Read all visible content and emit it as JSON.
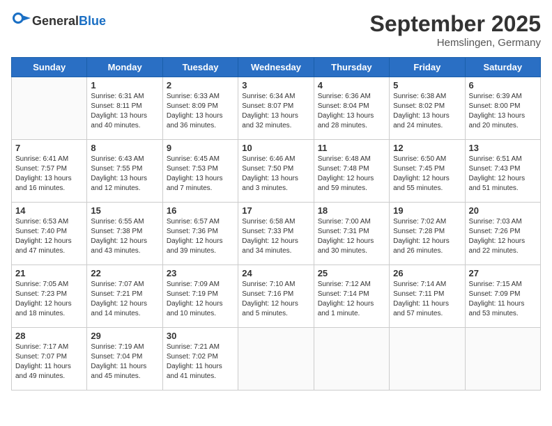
{
  "header": {
    "logo_general": "General",
    "logo_blue": "Blue",
    "month": "September 2025",
    "location": "Hemslingen, Germany"
  },
  "days_of_week": [
    "Sunday",
    "Monday",
    "Tuesday",
    "Wednesday",
    "Thursday",
    "Friday",
    "Saturday"
  ],
  "weeks": [
    [
      {
        "day": "",
        "details": []
      },
      {
        "day": "1",
        "details": [
          "Sunrise: 6:31 AM",
          "Sunset: 8:11 PM",
          "Daylight: 13 hours",
          "and 40 minutes."
        ]
      },
      {
        "day": "2",
        "details": [
          "Sunrise: 6:33 AM",
          "Sunset: 8:09 PM",
          "Daylight: 13 hours",
          "and 36 minutes."
        ]
      },
      {
        "day": "3",
        "details": [
          "Sunrise: 6:34 AM",
          "Sunset: 8:07 PM",
          "Daylight: 13 hours",
          "and 32 minutes."
        ]
      },
      {
        "day": "4",
        "details": [
          "Sunrise: 6:36 AM",
          "Sunset: 8:04 PM",
          "Daylight: 13 hours",
          "and 28 minutes."
        ]
      },
      {
        "day": "5",
        "details": [
          "Sunrise: 6:38 AM",
          "Sunset: 8:02 PM",
          "Daylight: 13 hours",
          "and 24 minutes."
        ]
      },
      {
        "day": "6",
        "details": [
          "Sunrise: 6:39 AM",
          "Sunset: 8:00 PM",
          "Daylight: 13 hours",
          "and 20 minutes."
        ]
      }
    ],
    [
      {
        "day": "7",
        "details": [
          "Sunrise: 6:41 AM",
          "Sunset: 7:57 PM",
          "Daylight: 13 hours",
          "and 16 minutes."
        ]
      },
      {
        "day": "8",
        "details": [
          "Sunrise: 6:43 AM",
          "Sunset: 7:55 PM",
          "Daylight: 13 hours",
          "and 12 minutes."
        ]
      },
      {
        "day": "9",
        "details": [
          "Sunrise: 6:45 AM",
          "Sunset: 7:53 PM",
          "Daylight: 13 hours",
          "and 7 minutes."
        ]
      },
      {
        "day": "10",
        "details": [
          "Sunrise: 6:46 AM",
          "Sunset: 7:50 PM",
          "Daylight: 13 hours",
          "and 3 minutes."
        ]
      },
      {
        "day": "11",
        "details": [
          "Sunrise: 6:48 AM",
          "Sunset: 7:48 PM",
          "Daylight: 12 hours",
          "and 59 minutes."
        ]
      },
      {
        "day": "12",
        "details": [
          "Sunrise: 6:50 AM",
          "Sunset: 7:45 PM",
          "Daylight: 12 hours",
          "and 55 minutes."
        ]
      },
      {
        "day": "13",
        "details": [
          "Sunrise: 6:51 AM",
          "Sunset: 7:43 PM",
          "Daylight: 12 hours",
          "and 51 minutes."
        ]
      }
    ],
    [
      {
        "day": "14",
        "details": [
          "Sunrise: 6:53 AM",
          "Sunset: 7:40 PM",
          "Daylight: 12 hours",
          "and 47 minutes."
        ]
      },
      {
        "day": "15",
        "details": [
          "Sunrise: 6:55 AM",
          "Sunset: 7:38 PM",
          "Daylight: 12 hours",
          "and 43 minutes."
        ]
      },
      {
        "day": "16",
        "details": [
          "Sunrise: 6:57 AM",
          "Sunset: 7:36 PM",
          "Daylight: 12 hours",
          "and 39 minutes."
        ]
      },
      {
        "day": "17",
        "details": [
          "Sunrise: 6:58 AM",
          "Sunset: 7:33 PM",
          "Daylight: 12 hours",
          "and 34 minutes."
        ]
      },
      {
        "day": "18",
        "details": [
          "Sunrise: 7:00 AM",
          "Sunset: 7:31 PM",
          "Daylight: 12 hours",
          "and 30 minutes."
        ]
      },
      {
        "day": "19",
        "details": [
          "Sunrise: 7:02 AM",
          "Sunset: 7:28 PM",
          "Daylight: 12 hours",
          "and 26 minutes."
        ]
      },
      {
        "day": "20",
        "details": [
          "Sunrise: 7:03 AM",
          "Sunset: 7:26 PM",
          "Daylight: 12 hours",
          "and 22 minutes."
        ]
      }
    ],
    [
      {
        "day": "21",
        "details": [
          "Sunrise: 7:05 AM",
          "Sunset: 7:23 PM",
          "Daylight: 12 hours",
          "and 18 minutes."
        ]
      },
      {
        "day": "22",
        "details": [
          "Sunrise: 7:07 AM",
          "Sunset: 7:21 PM",
          "Daylight: 12 hours",
          "and 14 minutes."
        ]
      },
      {
        "day": "23",
        "details": [
          "Sunrise: 7:09 AM",
          "Sunset: 7:19 PM",
          "Daylight: 12 hours",
          "and 10 minutes."
        ]
      },
      {
        "day": "24",
        "details": [
          "Sunrise: 7:10 AM",
          "Sunset: 7:16 PM",
          "Daylight: 12 hours",
          "and 5 minutes."
        ]
      },
      {
        "day": "25",
        "details": [
          "Sunrise: 7:12 AM",
          "Sunset: 7:14 PM",
          "Daylight: 12 hours",
          "and 1 minute."
        ]
      },
      {
        "day": "26",
        "details": [
          "Sunrise: 7:14 AM",
          "Sunset: 7:11 PM",
          "Daylight: 11 hours",
          "and 57 minutes."
        ]
      },
      {
        "day": "27",
        "details": [
          "Sunrise: 7:15 AM",
          "Sunset: 7:09 PM",
          "Daylight: 11 hours",
          "and 53 minutes."
        ]
      }
    ],
    [
      {
        "day": "28",
        "details": [
          "Sunrise: 7:17 AM",
          "Sunset: 7:07 PM",
          "Daylight: 11 hours",
          "and 49 minutes."
        ]
      },
      {
        "day": "29",
        "details": [
          "Sunrise: 7:19 AM",
          "Sunset: 7:04 PM",
          "Daylight: 11 hours",
          "and 45 minutes."
        ]
      },
      {
        "day": "30",
        "details": [
          "Sunrise: 7:21 AM",
          "Sunset: 7:02 PM",
          "Daylight: 11 hours",
          "and 41 minutes."
        ]
      },
      {
        "day": "",
        "details": []
      },
      {
        "day": "",
        "details": []
      },
      {
        "day": "",
        "details": []
      },
      {
        "day": "",
        "details": []
      }
    ]
  ]
}
